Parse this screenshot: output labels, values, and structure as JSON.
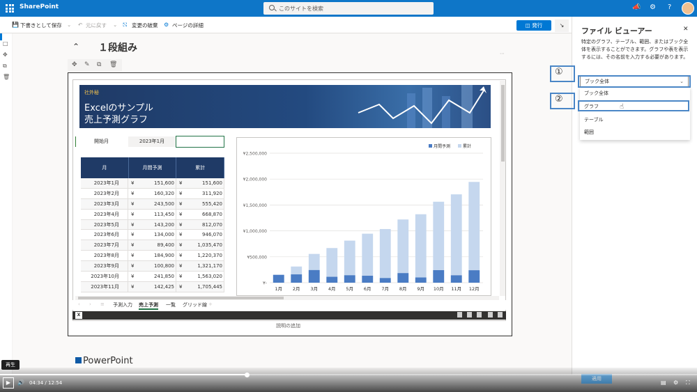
{
  "suitebar": {
    "app_title": "SharePoint",
    "search_placeholder": "このサイトを検索"
  },
  "commandbar": {
    "save_draft": "下書きとして保存",
    "undo": "元に戻す",
    "discard": "変更の破棄",
    "page_details": "ページの詳細",
    "publish": "発行"
  },
  "section": {
    "title": "１段組み"
  },
  "workbook": {
    "banner_tag": "社外秘",
    "banner_line1": "Excelのサンプル",
    "banner_line2": "売上予測グラフ",
    "start_month_label": "開始月",
    "start_month_value": "2023年1月",
    "table": {
      "headers": [
        "月",
        "月間予測",
        "累計"
      ],
      "currency": "¥",
      "rows": [
        [
          "2023年1月",
          "151,600",
          "151,600"
        ],
        [
          "2023年2月",
          "160,320",
          "311,920"
        ],
        [
          "2023年3月",
          "243,500",
          "555,420"
        ],
        [
          "2023年4月",
          "113,450",
          "668,870"
        ],
        [
          "2023年5月",
          "143,200",
          "812,070"
        ],
        [
          "2023年6月",
          "134,000",
          "946,070"
        ],
        [
          "2023年7月",
          "89,400",
          "1,035,470"
        ],
        [
          "2023年8月",
          "184,900",
          "1,220,370"
        ],
        [
          "2023年9月",
          "100,800",
          "1,321,170"
        ],
        [
          "2023年10月",
          "241,850",
          "1,563,020"
        ],
        [
          "2023年11月",
          "142,425",
          "1,705,445"
        ]
      ]
    },
    "sheet_tabs": [
      "予測入力",
      "売上予測",
      "一覧",
      "グリッド線"
    ],
    "active_tab": "売上予測",
    "add_tab": "+",
    "caption": "説明の追加"
  },
  "chart_data": {
    "type": "bar",
    "categories": [
      "1月",
      "2月",
      "3月",
      "4月",
      "5月",
      "6月",
      "7月",
      "8月",
      "9月",
      "10月",
      "11月",
      "12月"
    ],
    "series": [
      {
        "name": "月間予測",
        "values": [
          151600,
          160320,
          243500,
          113450,
          143200,
          134000,
          89400,
          184900,
          100800,
          241850,
          142425,
          240000
        ],
        "color": "#4a7cc4"
      },
      {
        "name": "累計",
        "values": [
          151600,
          311920,
          555420,
          668870,
          812070,
          946070,
          1035470,
          1220370,
          1321170,
          1563020,
          1705445,
          1945445
        ],
        "color": "#c5d7ee"
      }
    ],
    "ylim": [
      0,
      2500000
    ],
    "yticks": [
      "¥-",
      "¥500,000",
      "¥1,000,000",
      "¥1,500,000",
      "¥2,000,000",
      "¥2,500,000"
    ],
    "legend_position": "top-right",
    "grid": true
  },
  "next_section": {
    "title": "PowerPoint"
  },
  "panel": {
    "title": "ファイル ビューアー",
    "description": "特定のグラフ、テーブル、範囲、またはブック全体を表示することができます。グラフや表を表示するには、その名前を入力する必要があります。",
    "dropdown_value": "ブック全体",
    "options": [
      "ブック全体",
      "グラフ",
      "テーブル",
      "範囲"
    ],
    "marker1": "①",
    "marker2": "②",
    "apply": "適用"
  },
  "video": {
    "play_tooltip": "再生",
    "current_time": "04:34",
    "separator": "/",
    "duration": "12:54",
    "progress": 0.355
  },
  "colors": {
    "brand": "#0e76c8",
    "accent": "#0078d4",
    "excel": "#217346",
    "highlight": "#4a86c6"
  }
}
